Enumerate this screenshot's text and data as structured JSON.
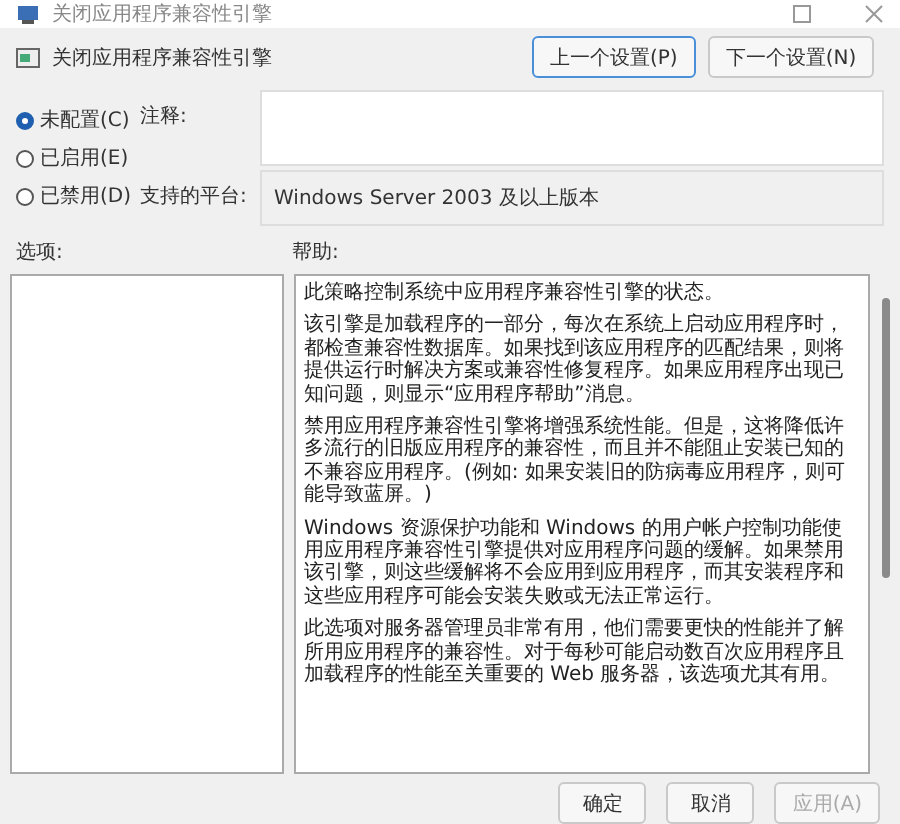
{
  "window": {
    "title": "关闭应用程序兼容性引擎"
  },
  "header": {
    "title": "关闭应用程序兼容性引擎",
    "buttons": [
      {
        "label": "上一个设置(P)",
        "focused": true
      },
      {
        "label": "下一个设置(N)",
        "focused": false
      }
    ]
  },
  "state_options": [
    {
      "label": "未配置(C)",
      "selected": true
    },
    {
      "label": "已启用(E)",
      "selected": false
    },
    {
      "label": "已禁用(D)",
      "selected": false
    }
  ],
  "comment": {
    "label": "注释:"
  },
  "platform": {
    "label": "支持的平台:",
    "value": "Windows Server 2003 及以上版本"
  },
  "options": {
    "label": "选项:"
  },
  "help": {
    "label": "帮助:",
    "paragraphs": [
      "此策略控制系统中应用程序兼容性引擎的状态。",
      "该引擎是加载程序的一部分，每次在系统上启动应用程序时，都检查兼容性数据库。如果找到该应用程序的匹配结果，则将提供运行时解决方案或兼容性修复程序。如果应用程序出现已知问题，则显示“应用程序帮助”消息。",
      "禁用应用程序兼容性引擎将增强系统性能。但是，这将降低许多流行的旧版应用程序的兼容性，而且并不能阻止安装已知的不兼容应用程序。(例如: 如果安装旧的防病毒应用程序，则可能导致蓝屏。)",
      "Windows 资源保护功能和 Windows 的用户帐户控制功能使用应用程序兼容性引擎提供对应用程序问题的缓解。如果禁用该引擎，则这些缓解将不会应用到应用程序，而其安装程序和这些应用程序可能会安装失败或无法正常运行。",
      "此选项对服务器管理员非常有用，他们需要更快的性能并了解所用应用程序的兼容性。对于每秒可能启动数百次应用程序且加载程序的性能至关重要的 Web 服务器，该选项尤其有用。"
    ]
  },
  "footer_buttons": [
    {
      "label": "确定",
      "disabled": false
    },
    {
      "label": "取消",
      "disabled": false
    },
    {
      "label": "应用(A)",
      "disabled": true
    }
  ]
}
